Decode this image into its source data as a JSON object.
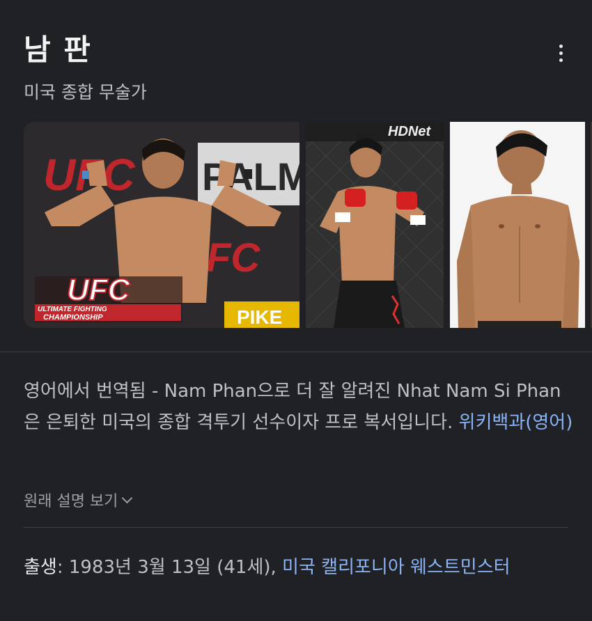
{
  "entity": {
    "title": "남 판",
    "subtitle": "미국 종합 무술가"
  },
  "menu": {
    "icon": "more-vert-icon"
  },
  "images": {
    "img1_overlay": {
      "ufc_text": "UFC",
      "tagline": "ULTIMATE FIGHTING CHAMPIONSHIP",
      "banner_text": "PALM",
      "pike_text": "PIKE"
    },
    "img2_overlay": {
      "network": "HDNet"
    }
  },
  "description": {
    "text": "영어에서 번역됨 - Nam Phan으로 더 잘 알려진 Nhat Nam Si Phan은 은퇴한 미국의 종합 격투기 선수이자 프로 복서입니다.",
    "source_link": "위키백과(영어)"
  },
  "original_toggle": {
    "label": "원래 설명 보기",
    "icon": "chevron-down-icon"
  },
  "facts": {
    "born_label": "출생",
    "born_sep": ":",
    "born_value": "1983년 3월 13일 (41세),",
    "born_place": "미국 캘리포니아 웨스트민스터"
  },
  "colors": {
    "background": "#202124",
    "link": "#8ab4f8",
    "text": "#bdc1c6"
  }
}
